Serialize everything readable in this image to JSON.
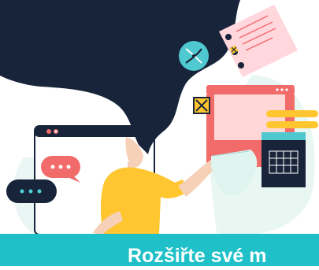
{
  "hero": {
    "illustration_subject": "woman-with-flowing-hair-reaching-to-ui-windows",
    "icons": [
      "chat-bubble-icon",
      "chat-bubble-icon",
      "dna-icon",
      "calendar-icon",
      "close-checkbox-icon",
      "notepad-icon",
      "document-icon"
    ]
  },
  "banner": {
    "title": "Rozšiřte své m"
  },
  "colors": {
    "accent": "#1fc0c8",
    "navy": "#17243a",
    "coral": "#f26b6b",
    "yellow": "#ffc62f",
    "pink_note": "#ffd7dc",
    "mint": "#dff4ef"
  }
}
